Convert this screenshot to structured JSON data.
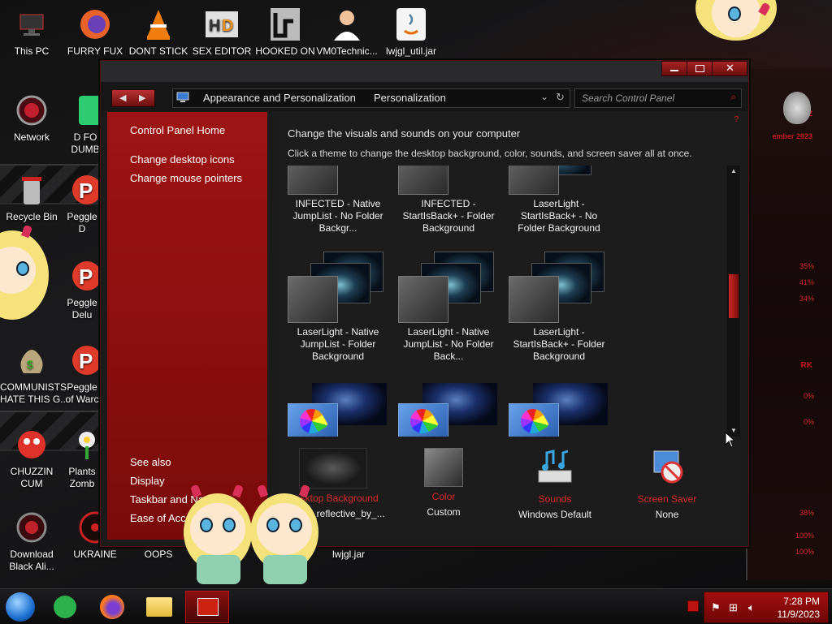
{
  "desktop": {
    "icons": [
      {
        "label": "This PC",
        "icon": "computer-icon"
      },
      {
        "label": "FURRY FUX",
        "icon": "firefox-icon"
      },
      {
        "label": "DONT STICK",
        "icon": "vlc-icon"
      },
      {
        "label": "SEX EDITOR",
        "icon": "hxd-editor-icon"
      },
      {
        "label": "HOOKED ON",
        "icon": "maze-game-icon"
      },
      {
        "label": "VM0Technic...",
        "icon": "doctor-icon"
      },
      {
        "label": "lwjgl_util.jar",
        "icon": "java-icon"
      },
      {
        "label": "Network",
        "icon": "network-icon"
      },
      {
        "label": "D FO\nDUMB",
        "icon": "app-icon"
      },
      {
        "label": "Recycle Bin",
        "icon": "recycle-bin-icon"
      },
      {
        "label": "Peggle D",
        "icon": "peggle-icon"
      },
      {
        "label": "Peggle\nDelu",
        "icon": "peggle-icon"
      },
      {
        "label": "COMMUNISTS\nHATE THIS G...",
        "icon": "money-bag-icon"
      },
      {
        "label": "Peggle\nof Warc",
        "icon": "peggle-icon"
      },
      {
        "label": "CHUZZIN\nCUM",
        "icon": "chuzzle-icon"
      },
      {
        "label": "Plants\nZomb",
        "icon": "plant-icon"
      },
      {
        "label": "Download\nBlack Ali...",
        "icon": "alien-icon"
      },
      {
        "label": "UKRAINE",
        "icon": "hazard-icon"
      },
      {
        "label": "OOPS",
        "icon": "app-icon"
      },
      {
        "label": "lwjgl.jar",
        "icon": "java-icon"
      }
    ],
    "right_panel": {
      "labels": [
        "02",
        "ember 2023",
        "RK"
      ],
      "percents": [
        "35%",
        "41%",
        "34%",
        "0%",
        "0%",
        "38%",
        "100%",
        "100%"
      ]
    }
  },
  "window": {
    "nav": {
      "back_label": "◀",
      "forward_label": "▶",
      "crumbs": [
        "Appearance and Personalization",
        "Personalization"
      ],
      "search_placeholder": "Search Control Panel"
    },
    "sidebar": {
      "home": "Control Panel Home",
      "links": [
        "Change desktop icons",
        "Change mouse pointers"
      ],
      "see_also_title": "See also",
      "see_also": [
        "Display",
        "Taskbar and Na",
        "Ease of Access"
      ]
    },
    "main": {
      "heading": "Change the visuals and sounds on your computer",
      "subheading": "Click a theme to change the desktop background, color, sounds, and screen saver all at once.",
      "themes": [
        {
          "name": "INFECTED - Native JumpList - No Folder Backgr..."
        },
        {
          "name": "INFECTED - StartIsBack+ - Folder Background"
        },
        {
          "name": "LaserLight - StartIsBack+ - No Folder Background"
        },
        {
          "name": "LaserLight - Native JumpList - Folder Background"
        },
        {
          "name": "LaserLight - Native JumpList - No Folder Back..."
        },
        {
          "name": "LaserLight - StartIsBack+ - Folder Background"
        },
        {
          "name": ""
        },
        {
          "name": ""
        },
        {
          "name": ""
        }
      ],
      "bottom": [
        {
          "label": "Desktop Background",
          "value": "hazard_reflective_by_...",
          "icon": "desktop-background-icon"
        },
        {
          "label": "Color",
          "value": "Custom",
          "icon": "color-icon"
        },
        {
          "label": "Sounds",
          "value": "Windows Default",
          "icon": "sounds-icon"
        },
        {
          "label": "Screen Saver",
          "value": "None",
          "icon": "screen-saver-icon"
        }
      ]
    }
  },
  "taskbar": {
    "apps": [
      "start-orb-icon",
      "feedly-icon",
      "firefox-icon",
      "file-explorer-icon",
      "control-panel-icon"
    ],
    "time": "7:28 PM",
    "date": "11/9/2023"
  },
  "colors": {
    "accent": "#b81414",
    "sidebar": "#8e1111",
    "label_red": "#d52a2a"
  }
}
